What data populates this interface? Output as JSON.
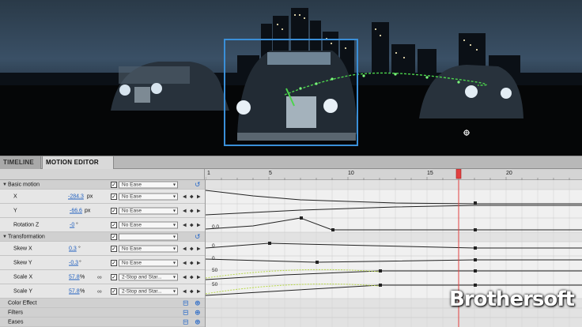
{
  "tabs": [
    "TIMELINE",
    "MOTION EDITOR"
  ],
  "ruler": {
    "frames": [
      "1",
      "5",
      "10",
      "15",
      "20"
    ]
  },
  "sections": {
    "basic_motion": "Basic motion",
    "transformation": "Transformation",
    "color_effect": "Color Effect",
    "filters": "Filters",
    "eases": "Eases"
  },
  "properties": [
    {
      "name": "X",
      "value": "-284.3",
      "unit": "px",
      "ease": "No Ease"
    },
    {
      "name": "Y",
      "value": "-66.6",
      "unit": "px",
      "ease": "No Ease"
    },
    {
      "name": "Rotation Z",
      "value": "-0",
      "unit": "°",
      "ease": "No Ease"
    },
    {
      "name": "Skew X",
      "value": "0.3",
      "unit": "°",
      "ease": "No Ease"
    },
    {
      "name": "Skew Y",
      "value": "-0.3",
      "unit": "°",
      "ease": "No Ease"
    },
    {
      "name": "Scale X",
      "value": "57.8",
      "unit": "%",
      "ease": "2-Stop and Star..."
    },
    {
      "name": "Scale Y",
      "value": "57.8",
      "unit": "%",
      "ease": "2-Stop and Star..."
    }
  ],
  "graph_labels": {
    "rotation": "0.0",
    "skew_x": "0",
    "skew_y": "0",
    "scale_x": "50",
    "scale_y": "50"
  },
  "watermark": "Brothersoft",
  "colors": {
    "selection_box": "#3a8fd8",
    "playhead": "#e24040",
    "motion_path": "#4cd44c",
    "ease_curve": "#b8d84a",
    "link": "#1f5fbf"
  }
}
